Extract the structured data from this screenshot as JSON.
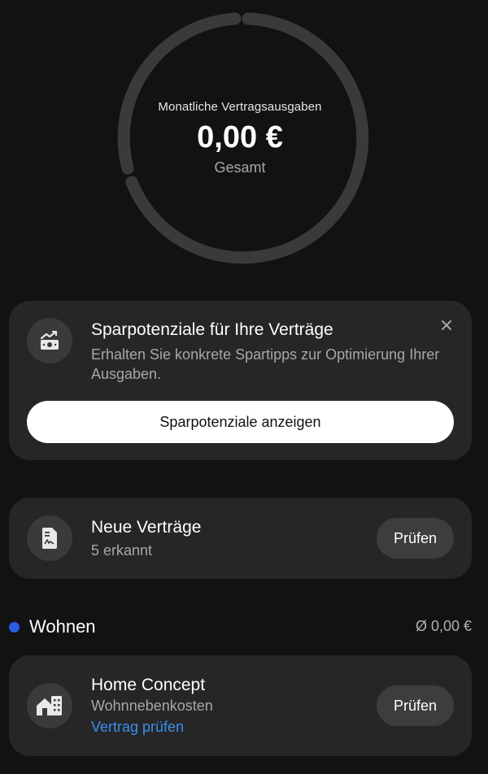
{
  "summary": {
    "title": "Monatliche Vertragsausgaben",
    "amount": "0,00 €",
    "subtitle": "Gesamt"
  },
  "savings_card": {
    "icon": "savings-growth-icon",
    "title": "Sparpotenziale für Ihre Verträge",
    "description": "Erhalten Sie konkrete Spartipps zur Optimierung Ihrer Ausgaben.",
    "close_icon": "close-icon",
    "button_label": "Sparpotenziale anzeigen"
  },
  "new_contracts_card": {
    "icon": "document-icon",
    "title": "Neue Verträge",
    "subtitle": "5 erkannt",
    "button_label": "Prüfen"
  },
  "section": {
    "title": "Wohnen",
    "amount": "Ø 0,00 €",
    "color": "#2b5ce5"
  },
  "home_card": {
    "icon": "house-building-icon",
    "title": "Home Concept",
    "subtitle": "Wohnnebenkosten",
    "link": "Vertrag prüfen",
    "button_label": "Prüfen"
  },
  "colors": {
    "background": "#121212",
    "card": "#262626",
    "accent_blue": "#3a8ef0",
    "ring": "#3a3a3a"
  }
}
